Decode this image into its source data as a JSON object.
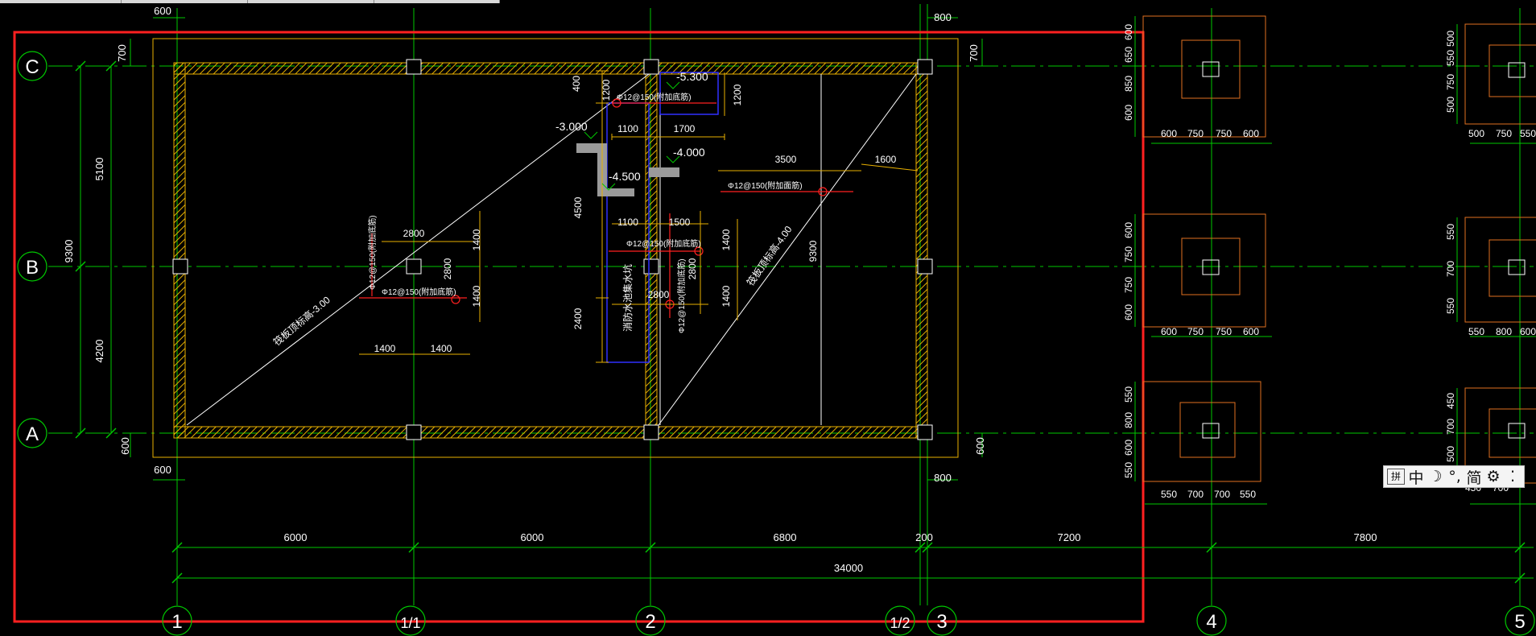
{
  "grid_bubbles": {
    "rows": [
      {
        "id": "row-c",
        "label": "C"
      },
      {
        "id": "row-b",
        "label": "B"
      },
      {
        "id": "row-a",
        "label": "A"
      }
    ],
    "cols": [
      {
        "id": "col-1",
        "label": "1"
      },
      {
        "id": "col-1-1",
        "label": "1/1"
      },
      {
        "id": "col-2",
        "label": "2"
      },
      {
        "id": "col-1-2",
        "label": "1/2"
      },
      {
        "id": "col-3",
        "label": "3"
      },
      {
        "id": "col-4",
        "label": "4"
      },
      {
        "id": "col-5",
        "label": "5"
      }
    ]
  },
  "dimensions": {
    "bottom_spans": [
      "6000",
      "6000",
      "6800",
      "200",
      "7200",
      "7800"
    ],
    "overall": "34000",
    "left_spans": [
      "5100",
      "4200"
    ],
    "left_total": "9300",
    "edge_600": "600",
    "edge_700": "700",
    "edge_800": "800",
    "plan_inner": [
      "400",
      "1200",
      "1100",
      "1700",
      "1200",
      "3500",
      "1600",
      "4500",
      "2400",
      "9300",
      "1100",
      "1500",
      "1400",
      "2800",
      "1400",
      "2800",
      "1400",
      "1400",
      "1400",
      "1400",
      "1400",
      "2800",
      "2800"
    ]
  },
  "elevations": {
    "e1": "-5.300",
    "e2": "-3.000",
    "e3": "-4.000",
    "e4": "-4.500"
  },
  "annotations": {
    "slab_left": "筏板顶标高-3.00",
    "slab_right": "筏板顶标高-4.00",
    "pit": "消防水池集水坑",
    "rebar_bottom": "Φ12@150(附加底筋)",
    "rebar_face": "Φ12@150(附加面筋)"
  },
  "footings": {
    "f1_v": [
      "600",
      "650",
      "850",
      "600"
    ],
    "f1_h": [
      "600",
      "750",
      "750",
      "600"
    ],
    "f2_v": [
      "600",
      "750",
      "750",
      "600"
    ],
    "f2_h": [
      "600",
      "750",
      "750",
      "600"
    ],
    "f3_v": [
      "550",
      "800",
      "600",
      "550"
    ],
    "f3_h": [
      "550",
      "700",
      "700",
      "550"
    ],
    "f4_v": [
      "500",
      "550",
      "750",
      "500"
    ],
    "f4_h": [
      "500",
      "750",
      "550"
    ],
    "f5_v": [
      "550",
      "700",
      "550"
    ],
    "f5_h": [
      "550",
      "800",
      "600"
    ],
    "f6_v": [
      "450",
      "700",
      "500"
    ],
    "f6_h": [
      "450",
      "700"
    ]
  },
  "ime": {
    "grip": "拼",
    "mode": "中",
    "moon": "☽",
    "punct": "°,",
    "simp": "简",
    "gear": "⚙",
    "more": "⁚"
  },
  "colors": {
    "grid": "#00c800",
    "dim": "#e8b000",
    "wall": "#e8b000",
    "red": "#ff2020",
    "line": "#ffffff",
    "blue": "#3030ff",
    "orange": "#e07020"
  }
}
